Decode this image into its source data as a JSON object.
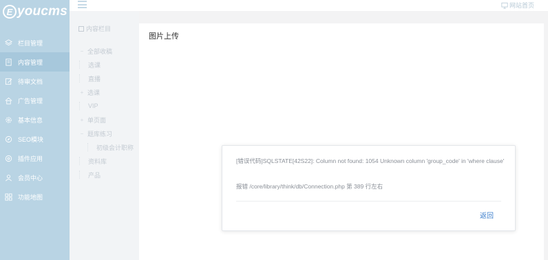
{
  "app": {
    "logo_letter": "E",
    "logo_text": "youcms"
  },
  "sidebar": {
    "items": [
      {
        "label": "栏目管理",
        "icon": "layers-icon"
      },
      {
        "label": "内容管理",
        "icon": "document-icon"
      },
      {
        "label": "待审文档",
        "icon": "edit-icon"
      },
      {
        "label": "广告管理",
        "icon": "home-icon"
      },
      {
        "label": "基本信息",
        "icon": "gear-icon"
      },
      {
        "label": "SEO模块",
        "icon": "compass-icon"
      },
      {
        "label": "插件应用",
        "icon": "plugin-icon"
      },
      {
        "label": "会员中心",
        "icon": "user-icon"
      },
      {
        "label": "功能地图",
        "icon": "grid-icon"
      }
    ],
    "active_index": 1
  },
  "topbar": {
    "site_home_label": "网站首页",
    "site_home_icon": "monitor-icon",
    "menu_icon": "hamburger-icon"
  },
  "tree": {
    "title": "内容栏目",
    "nodes": [
      {
        "label": "全部收稿",
        "toggle": "−",
        "level": 0
      },
      {
        "label": "选课",
        "toggle": "",
        "level": 0
      },
      {
        "label": "直播",
        "toggle": "",
        "level": 0
      },
      {
        "label": "选课",
        "toggle": "+",
        "level": 0
      },
      {
        "label": "VIP",
        "toggle": "",
        "level": 0
      },
      {
        "label": "单页面",
        "toggle": "+",
        "level": 0
      },
      {
        "label": "题库练习",
        "toggle": "−",
        "level": 0
      },
      {
        "label": "初级会计职称",
        "toggle": "",
        "level": 1
      },
      {
        "label": "资料库",
        "toggle": "",
        "level": 0
      },
      {
        "label": "产品",
        "toggle": "",
        "level": 0
      }
    ]
  },
  "content": {
    "title": "图片上传"
  },
  "dialog": {
    "error_message": "[错误代码]SQLSTATE[42S22]: Column not found: 1054 Unknown column 'group_code' in 'where clause'",
    "path_message": "报错 /core/library/think/db/Connection.php 第 389 行左右",
    "back_label": "返回"
  },
  "colors": {
    "sidebar_bg": "#b9d4e4",
    "sidebar_active": "#a7c8dc",
    "link": "#3d7fcc"
  }
}
